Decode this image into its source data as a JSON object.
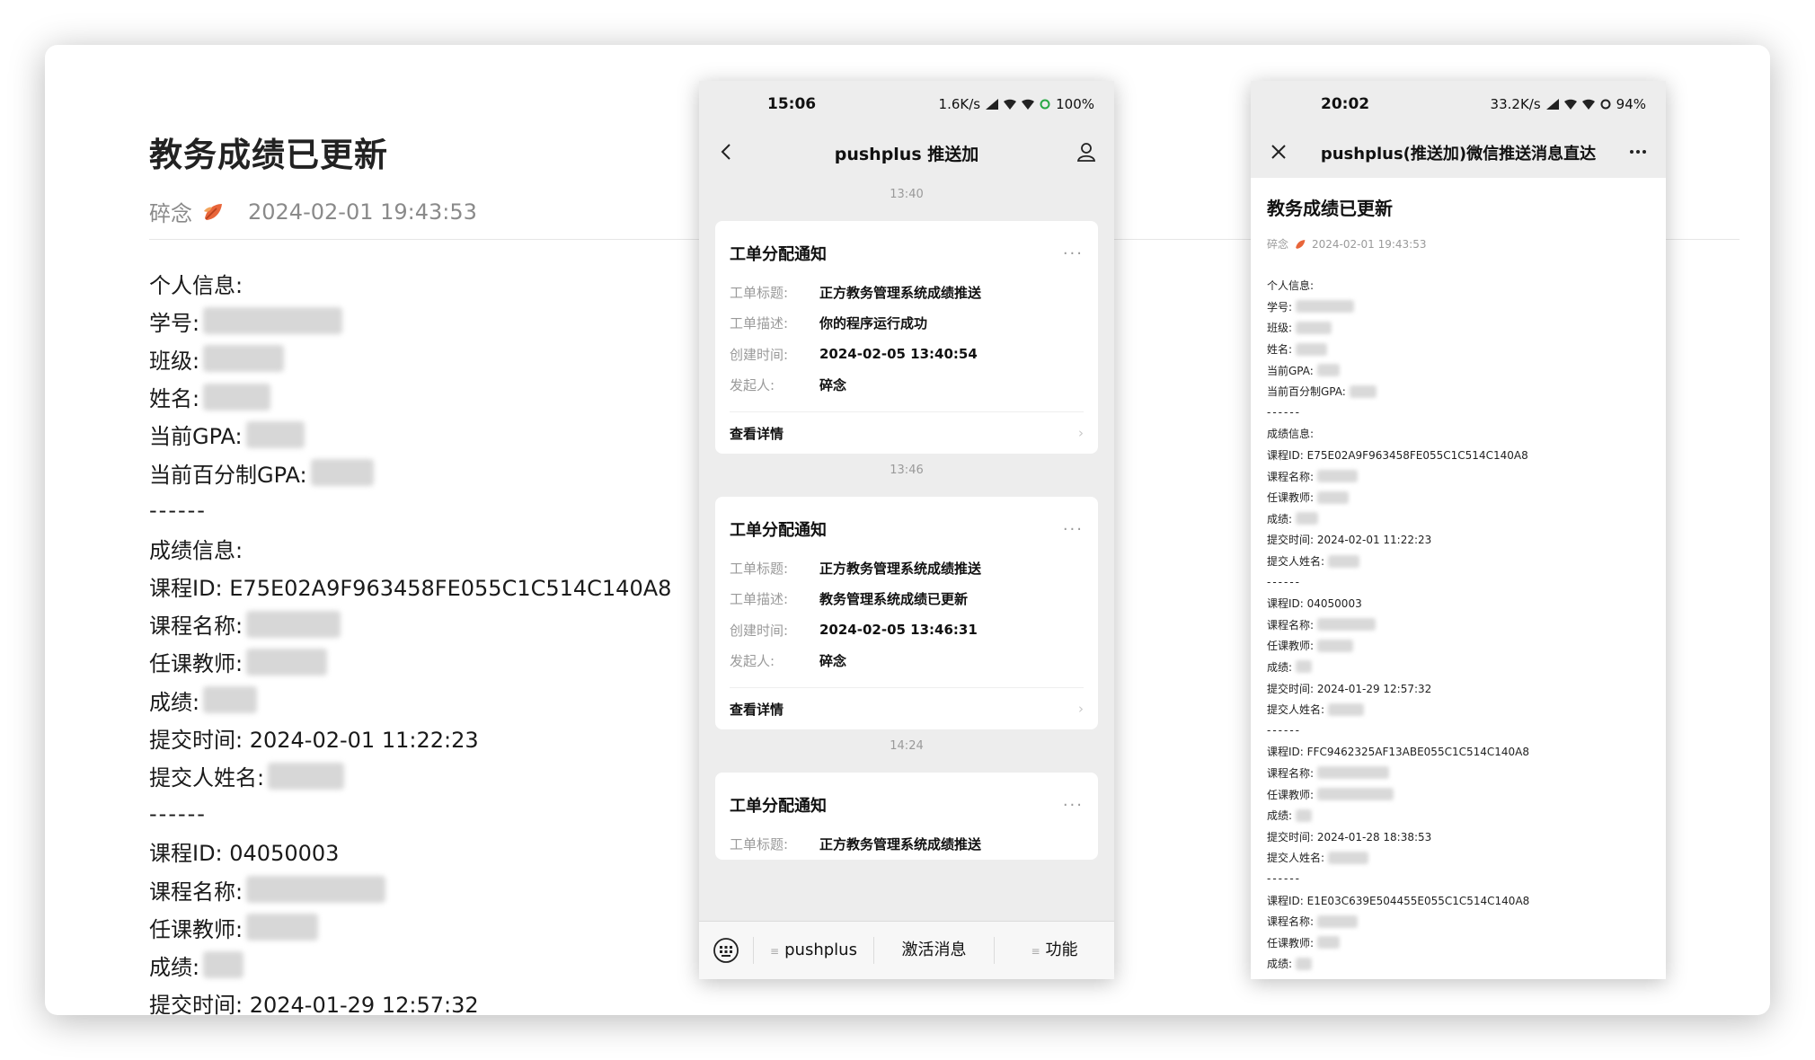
{
  "doc": {
    "title": "教务成绩已更新",
    "author": "碎念",
    "date": "2024-02-01 19:43:53",
    "lines": [
      {
        "text": "个人信息:",
        "blur": 0
      },
      {
        "text": "学号:",
        "blur": 155
      },
      {
        "text": "班级:",
        "blur": 90
      },
      {
        "text": "姓名:",
        "blur": 75
      },
      {
        "text": "当前GPA:",
        "blur": 65
      },
      {
        "text": "当前百分制GPA:",
        "blur": 70
      },
      {
        "text": "------",
        "blur": 0
      },
      {
        "text": "成绩信息:",
        "blur": 0
      },
      {
        "text": "课程ID: E75E02A9F963458FE055C1C514C140A8",
        "blur": 0
      },
      {
        "text": "课程名称:",
        "blur": 105
      },
      {
        "text": "任课教师:",
        "blur": 90
      },
      {
        "text": "成绩:",
        "blur": 60
      },
      {
        "text": "提交时间: 2024-02-01 11:22:23",
        "blur": 0
      },
      {
        "text": "提交人姓名:",
        "blur": 85
      },
      {
        "text": "------",
        "blur": 0
      },
      {
        "text": "课程ID: 04050003",
        "blur": 0
      },
      {
        "text": "课程名称:",
        "blur": 155
      },
      {
        "text": "任课教师:",
        "blur": 80
      },
      {
        "text": "成绩:",
        "blur": 45
      },
      {
        "text": "提交时间: 2024-01-29 12:57:32",
        "blur": 0
      }
    ]
  },
  "phone1": {
    "status_time": "15:06",
    "status_right": "1.6K/s",
    "battery": "100",
    "title": "pushplus 推送加",
    "messages": [
      {
        "timestamp": "13:40",
        "title": "工单分配通知",
        "rows": [
          {
            "k": "工单标题:",
            "v": "正方教务管理系统成绩推送"
          },
          {
            "k": "工单描述:",
            "v": "你的程序运行成功"
          },
          {
            "k": "创建时间:",
            "v": "2024-02-05 13:40:54"
          },
          {
            "k": "发起人:",
            "v": "碎念"
          }
        ],
        "link": "查看详情"
      },
      {
        "timestamp": "13:46",
        "title": "工单分配通知",
        "rows": [
          {
            "k": "工单标题:",
            "v": "正方教务管理系统成绩推送"
          },
          {
            "k": "工单描述:",
            "v": "教务管理系统成绩已更新"
          },
          {
            "k": "创建时间:",
            "v": "2024-02-05 13:46:31"
          },
          {
            "k": "发起人:",
            "v": "碎念"
          }
        ],
        "link": "查看详情"
      },
      {
        "timestamp": "14:24",
        "title": "工单分配通知",
        "rows": [
          {
            "k": "工单标题:",
            "v": "正方教务管理系统成绩推送"
          }
        ],
        "link": ""
      }
    ],
    "bottom": [
      "pushplus",
      "激活消息",
      "功能"
    ]
  },
  "phone2": {
    "status_time": "20:02",
    "status_right": "33.2K/s",
    "battery": "94",
    "title": "pushplus(推送加)微信推送消息直达",
    "article_title": "教务成绩已更新",
    "author": "碎念",
    "date": "2024-02-01 19:43:53",
    "lines": [
      {
        "text": "个人信息:",
        "blur": 0
      },
      {
        "text": "学号:",
        "blur": 65
      },
      {
        "text": "班级:",
        "blur": 40
      },
      {
        "text": "姓名:",
        "blur": 35
      },
      {
        "text": "当前GPA:",
        "blur": 25
      },
      {
        "text": "当前百分制GPA:",
        "blur": 30
      },
      {
        "text": "------",
        "blur": 0
      },
      {
        "text": "成绩信息:",
        "blur": 0
      },
      {
        "text": "课程ID: E75E02A9F963458FE055C1C514C140A8",
        "blur": 0
      },
      {
        "text": "课程名称:",
        "blur": 45
      },
      {
        "text": "任课教师:",
        "blur": 35
      },
      {
        "text": "成绩:",
        "blur": 25
      },
      {
        "text": "提交时间: 2024-02-01 11:22:23",
        "blur": 0
      },
      {
        "text": "提交人姓名:",
        "blur": 35
      },
      {
        "text": "------",
        "blur": 0
      },
      {
        "text": "课程ID: 04050003",
        "blur": 0
      },
      {
        "text": "课程名称:",
        "blur": 65
      },
      {
        "text": "任课教师:",
        "blur": 40
      },
      {
        "text": "成绩:",
        "blur": 18
      },
      {
        "text": "提交时间: 2024-01-29 12:57:32",
        "blur": 0
      },
      {
        "text": "提交人姓名:",
        "blur": 40
      },
      {
        "text": "------",
        "blur": 0
      },
      {
        "text": "课程ID: FFC9462325AF13ABE055C1C514C140A8",
        "blur": 0
      },
      {
        "text": "课程名称:",
        "blur": 80
      },
      {
        "text": "任课教师:",
        "blur": 85
      },
      {
        "text": "成绩:",
        "blur": 18
      },
      {
        "text": "提交时间: 2024-01-28 18:38:53",
        "blur": 0
      },
      {
        "text": "提交人姓名:",
        "blur": 45
      },
      {
        "text": "------",
        "blur": 0
      },
      {
        "text": "课程ID: E1E03C639E504455E055C1C514C140A8",
        "blur": 0
      },
      {
        "text": "课程名称:",
        "blur": 45
      },
      {
        "text": "任课教师:",
        "blur": 25
      },
      {
        "text": "成绩:",
        "blur": 18
      }
    ]
  },
  "colors": {
    "accent_battery": "#27a844",
    "leaf": "#e8653a"
  }
}
